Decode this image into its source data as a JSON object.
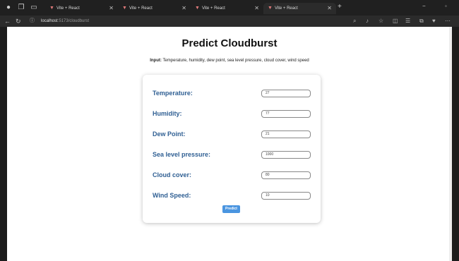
{
  "browser": {
    "tabs": [
      {
        "label": "Vite + React",
        "active": false
      },
      {
        "label": "Vite + React",
        "active": false
      },
      {
        "label": "Vite + React",
        "active": false
      },
      {
        "label": "Vite + React",
        "active": true
      }
    ],
    "address": {
      "host": "localhost",
      "path": ":5173/cloudburst"
    }
  },
  "page": {
    "title": "Predict Cloudburst",
    "input_label": "Input:",
    "input_desc": "Temperature, humidity, dew point, sea level pressure, cloud cover, wind speed"
  },
  "form": {
    "fields": [
      {
        "label": "Temperature:",
        "value": "27"
      },
      {
        "label": "Humidity:",
        "value": "77"
      },
      {
        "label": "Dew Point:",
        "value": "21"
      },
      {
        "label": "Sea level pressure:",
        "value": "1000"
      },
      {
        "label": "Cloud cover:",
        "value": "80"
      },
      {
        "label": "Wind Speed:",
        "value": "10"
      }
    ],
    "predict_label": "Predict"
  },
  "colors": {
    "accent": "#4a95e0",
    "label": "#2f5f93"
  }
}
